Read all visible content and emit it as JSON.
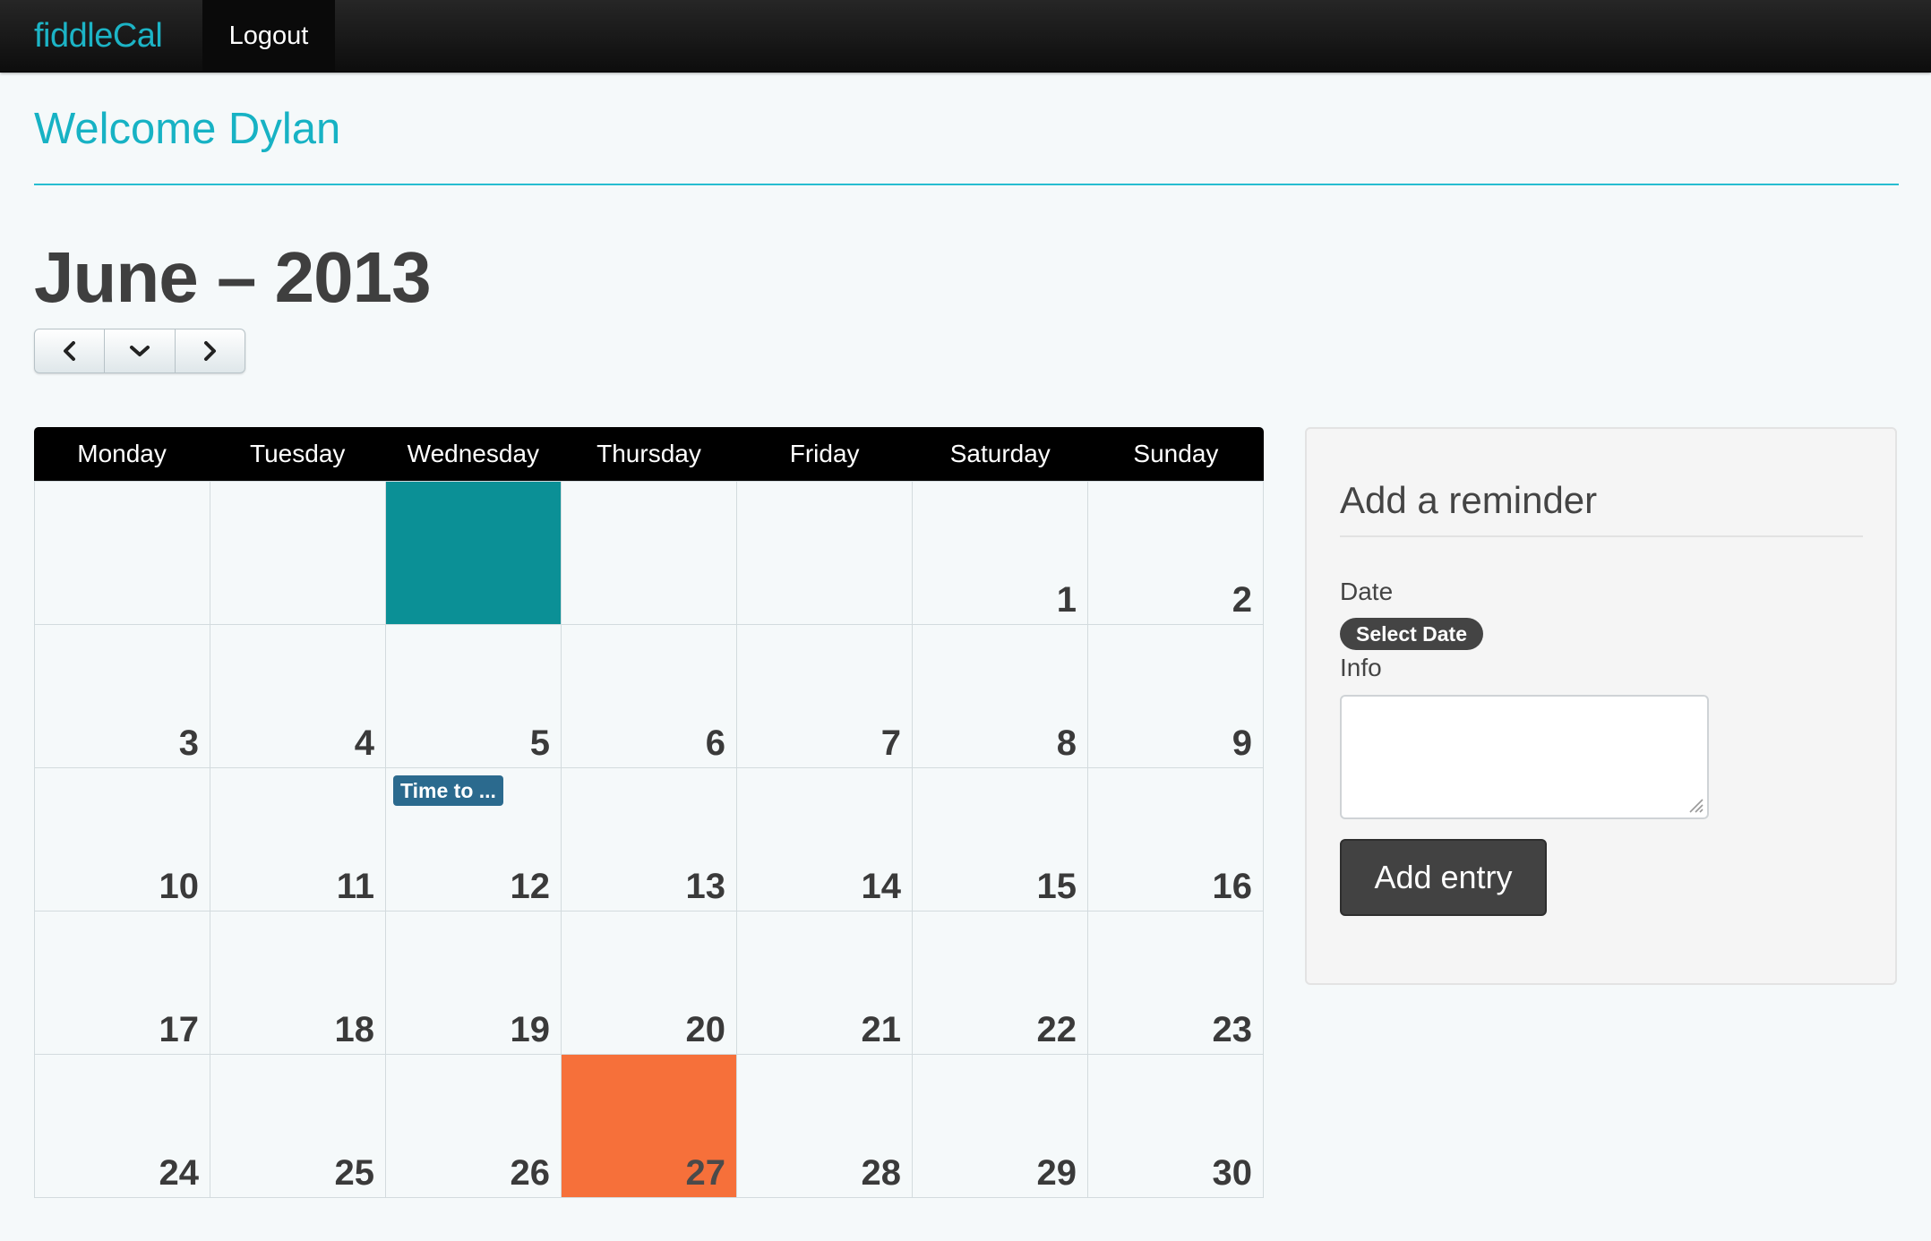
{
  "navbar": {
    "brand": "fiddleCal",
    "logout": "Logout"
  },
  "header": {
    "welcome": "Welcome Dylan"
  },
  "calendar": {
    "title": "June – 2013",
    "nav_icons": [
      "chevron-left-icon",
      "chevron-down-icon",
      "chevron-right-icon"
    ],
    "weekdays": [
      "Monday",
      "Tuesday",
      "Wednesday",
      "Thursday",
      "Friday",
      "Saturday",
      "Sunday"
    ],
    "weeks": [
      [
        "",
        "",
        "",
        "",
        "",
        "1",
        "2"
      ],
      [
        "3",
        "4",
        "5",
        "6",
        "7",
        "8",
        "9"
      ],
      [
        "10",
        "11",
        "12",
        "13",
        "14",
        "15",
        "16"
      ],
      [
        "17",
        "18",
        "19",
        "20",
        "21",
        "22",
        "23"
      ],
      [
        "24",
        "25",
        "26",
        "27",
        "28",
        "29",
        "30"
      ]
    ],
    "selected_cell": "week 1, Wednesday (empty)",
    "today": "27",
    "events": [
      {
        "day": "12",
        "label": "Time to ..."
      }
    ],
    "colors": {
      "selected": "#0b9096",
      "today": "#f6703a",
      "event": "#2b6a8e",
      "accent": "#17b2c4"
    }
  },
  "reminder": {
    "title": "Add a reminder",
    "date_label": "Date",
    "date_button": "Select Date",
    "info_label": "Info",
    "info_value": "",
    "submit": "Add entry"
  }
}
